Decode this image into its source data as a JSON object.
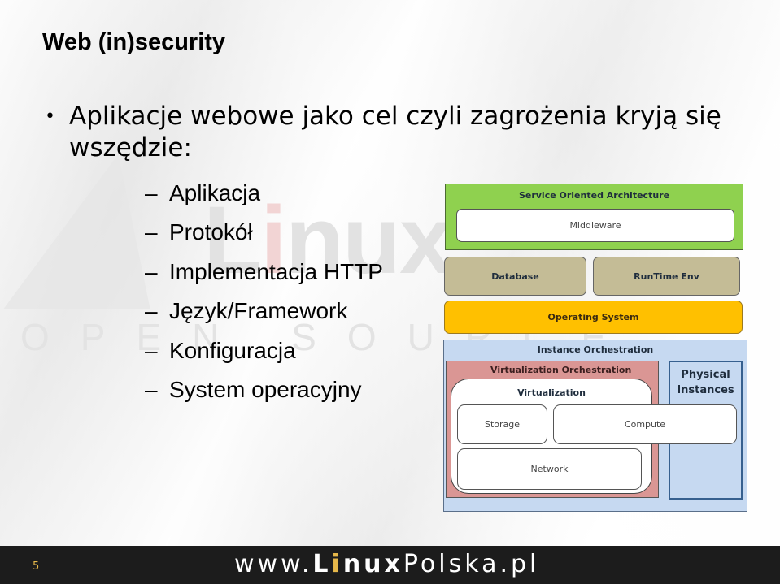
{
  "slide": {
    "title": "Web (in)security",
    "bullet": "Aplikacje webowe jako cel czyli zagrożenia kryją się wszędzie:",
    "bullet_marker": "•",
    "sub_dash": "–",
    "sub_items": [
      "Aplikacja",
      "Protokół",
      "Implementacja HTTP",
      "Język/Framework",
      "Konfiguracja",
      "System operacyjny"
    ],
    "page_number": "5"
  },
  "watermark": {
    "brand": "Linux",
    "brand_prefix": "L",
    "brand_i": "i",
    "brand_suffix": "nux",
    "tagline": "OPEN SOURCE"
  },
  "diagram": {
    "soa": "Service Oriented Architecture",
    "middleware": "Middleware",
    "database": "Database",
    "runtime": "RunTime Env",
    "os": "Operating System",
    "instance_orchestration": "Instance Orchestration",
    "virtualization_orchestration": "Virtualization Orchestration",
    "virtualization": "Virtualization",
    "physical_instances": "Physical Instances",
    "storage": "Storage",
    "compute": "Compute",
    "network": "Network",
    "colors": {
      "soa": "#8fd14f",
      "layer_tan": "#c4bc96",
      "os": "#ffc000",
      "instance": "#c6d9f1",
      "virt_orch": "#da9694"
    }
  },
  "footer": {
    "url_prefix": "www.",
    "url_L": "L",
    "url_i": "i",
    "url_nux": "nux",
    "url_rest": "Polska.pl",
    "accent_color": "#e6b84a"
  }
}
